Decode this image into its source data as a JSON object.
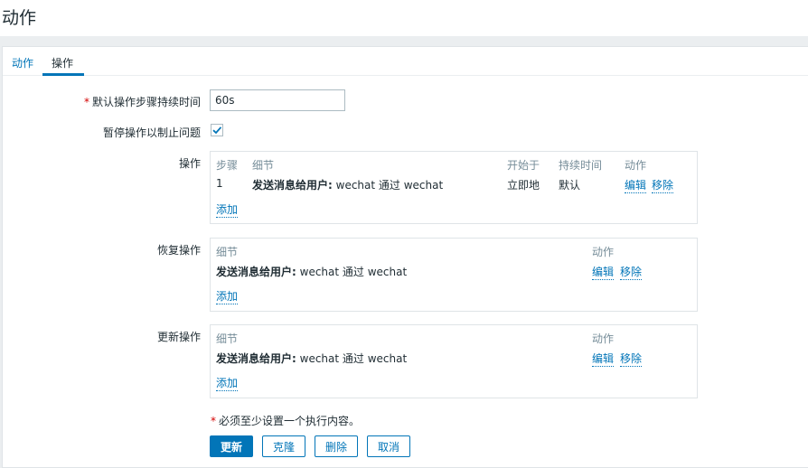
{
  "page": {
    "title": "动作"
  },
  "tabs": [
    {
      "label": "动作"
    },
    {
      "label": "操作"
    }
  ],
  "form": {
    "default_duration": {
      "label": "默认操作步骤持续时间",
      "value": "60s"
    },
    "pause": {
      "label": "暂停操作以制止问题",
      "checked": true
    },
    "operations": {
      "label": "操作",
      "headers": {
        "step": "步骤",
        "details": "细节",
        "start": "开始于",
        "duration": "持续时间",
        "action": "动作"
      },
      "rows": [
        {
          "step": "1",
          "details_bold": "发送消息给用户:",
          "details_rest": " wechat 通过 wechat",
          "start": "立即地",
          "duration": "默认",
          "edit": "编辑",
          "remove": "移除"
        }
      ],
      "add": "添加"
    },
    "recovery": {
      "label": "恢复操作",
      "headers": {
        "details": "细节",
        "action": "动作"
      },
      "rows": [
        {
          "details_bold": "发送消息给用户:",
          "details_rest": " wechat 通过 wechat",
          "edit": "编辑",
          "remove": "移除"
        }
      ],
      "add": "添加"
    },
    "update": {
      "label": "更新操作",
      "headers": {
        "details": "细节",
        "action": "动作"
      },
      "rows": [
        {
          "details_bold": "发送消息给用户:",
          "details_rest": " wechat 通过 wechat",
          "edit": "编辑",
          "remove": "移除"
        }
      ],
      "add": "添加"
    },
    "footnote": "必须至少设置一个执行内容。"
  },
  "buttons": {
    "update": "更新",
    "clone": "克隆",
    "delete": "删除",
    "cancel": "取消"
  },
  "icons": {
    "checkbox": "check-icon"
  },
  "colors": {
    "accent": "#0275b8",
    "required": "#d40000",
    "header_muted": "#768d99",
    "background": "#ebeef0"
  }
}
